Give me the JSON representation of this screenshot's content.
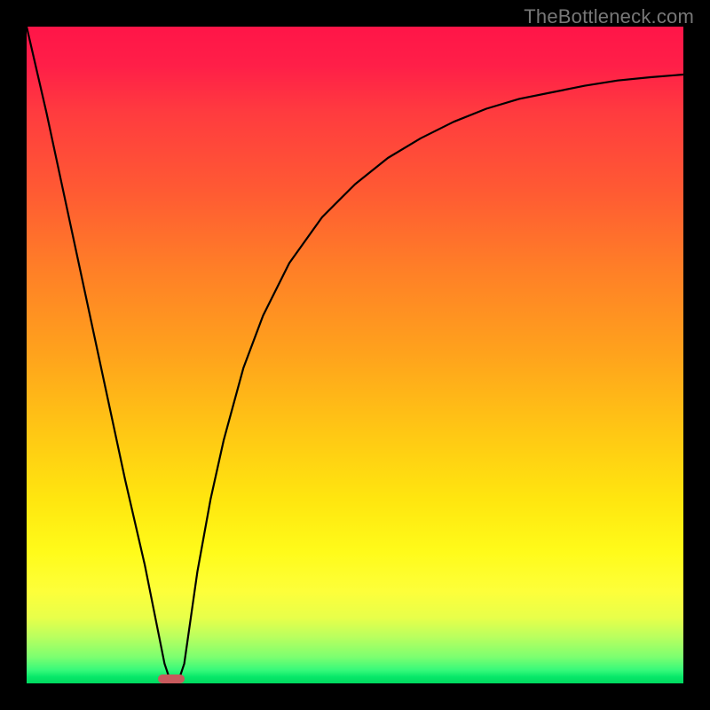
{
  "watermark": "TheBottleneck.com",
  "chart_data": {
    "type": "line",
    "title": "",
    "xlabel": "",
    "ylabel": "",
    "xlim": [
      0,
      100
    ],
    "ylim": [
      0,
      100
    ],
    "grid": false,
    "series": [
      {
        "name": "curve",
        "x": [
          0,
          3,
          6,
          9,
          12,
          15,
          18,
          20,
          21,
          22,
          23,
          24,
          25,
          26,
          28,
          30,
          33,
          36,
          40,
          45,
          50,
          55,
          60,
          65,
          70,
          75,
          80,
          85,
          90,
          95,
          100
        ],
        "values": [
          100,
          87,
          73,
          59,
          45,
          31,
          18,
          8,
          3,
          0,
          0,
          3,
          10,
          17,
          28,
          37,
          48,
          56,
          64,
          71,
          76,
          80,
          83,
          85.5,
          87.5,
          89,
          90,
          91,
          91.8,
          92.3,
          92.7
        ]
      }
    ],
    "annotations": {
      "marker": {
        "x": 22,
        "y": 0,
        "width": 4,
        "height": 1.4,
        "color": "#c85a5d"
      }
    },
    "background_gradient": {
      "direction": "vertical",
      "stops": [
        {
          "pos": 0.0,
          "color": "#ff1548"
        },
        {
          "pos": 0.5,
          "color": "#ffa31c"
        },
        {
          "pos": 0.8,
          "color": "#fffb1a"
        },
        {
          "pos": 1.0,
          "color": "#00d85f"
        }
      ]
    }
  }
}
